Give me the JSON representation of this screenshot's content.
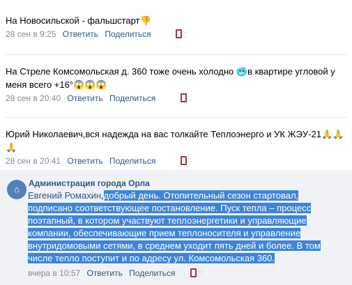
{
  "comments": [
    {
      "text": "На Новосильской - фальшстарт",
      "emoji": "👎",
      "time": "28 сен в 9:25",
      "reply_label": "Ответить",
      "share_label": "Поделиться"
    },
    {
      "text": "На Стреле Комсомольская д. 360 тоже очень холодно",
      "emoji_mid": "🥶",
      "text2": "в квартире угловой у меня всего +16°",
      "emoji_end": "😱😱😱",
      "time": "28 сен в 20:40",
      "reply_label": "Ответить",
      "share_label": "Поделиться"
    },
    {
      "text": "Юрий Николаевич,вся надежда на вас толкайте Теплоэнерго и УК ЖЭУ-21",
      "emoji": "🙏🙏🙏",
      "time": "28 сен в 20:41",
      "reply_label": "Ответить",
      "share_label": "Поделиться"
    }
  ],
  "reply": {
    "author": "Администрация города Орла",
    "mention": "Евгений Ромахин",
    "text": "добрый день. Отопительный сезон стартовал, подписано соответствующее постановление. Пуск тепла – процесс поэтапный, в котором участвуют теплоэнергетики и управляющие компании, обеспечивающие прием теплоносителя и управление внутридомовыми сетями, в среднем уходит пять дней и более. В том числе тепло поступит и по адресу ул. Комсомольская 360.",
    "time": "вчера в 10:57",
    "reply_label": "Ответить",
    "share_label": "Поделиться"
  },
  "icons": {
    "like": "like-heart-icon",
    "avatar": "organization-avatar-icon"
  },
  "colors": {
    "link": "#2a5885",
    "meta": "#818c99",
    "highlight": "#3d85d8",
    "reply_bg": "#f0f2f5"
  }
}
